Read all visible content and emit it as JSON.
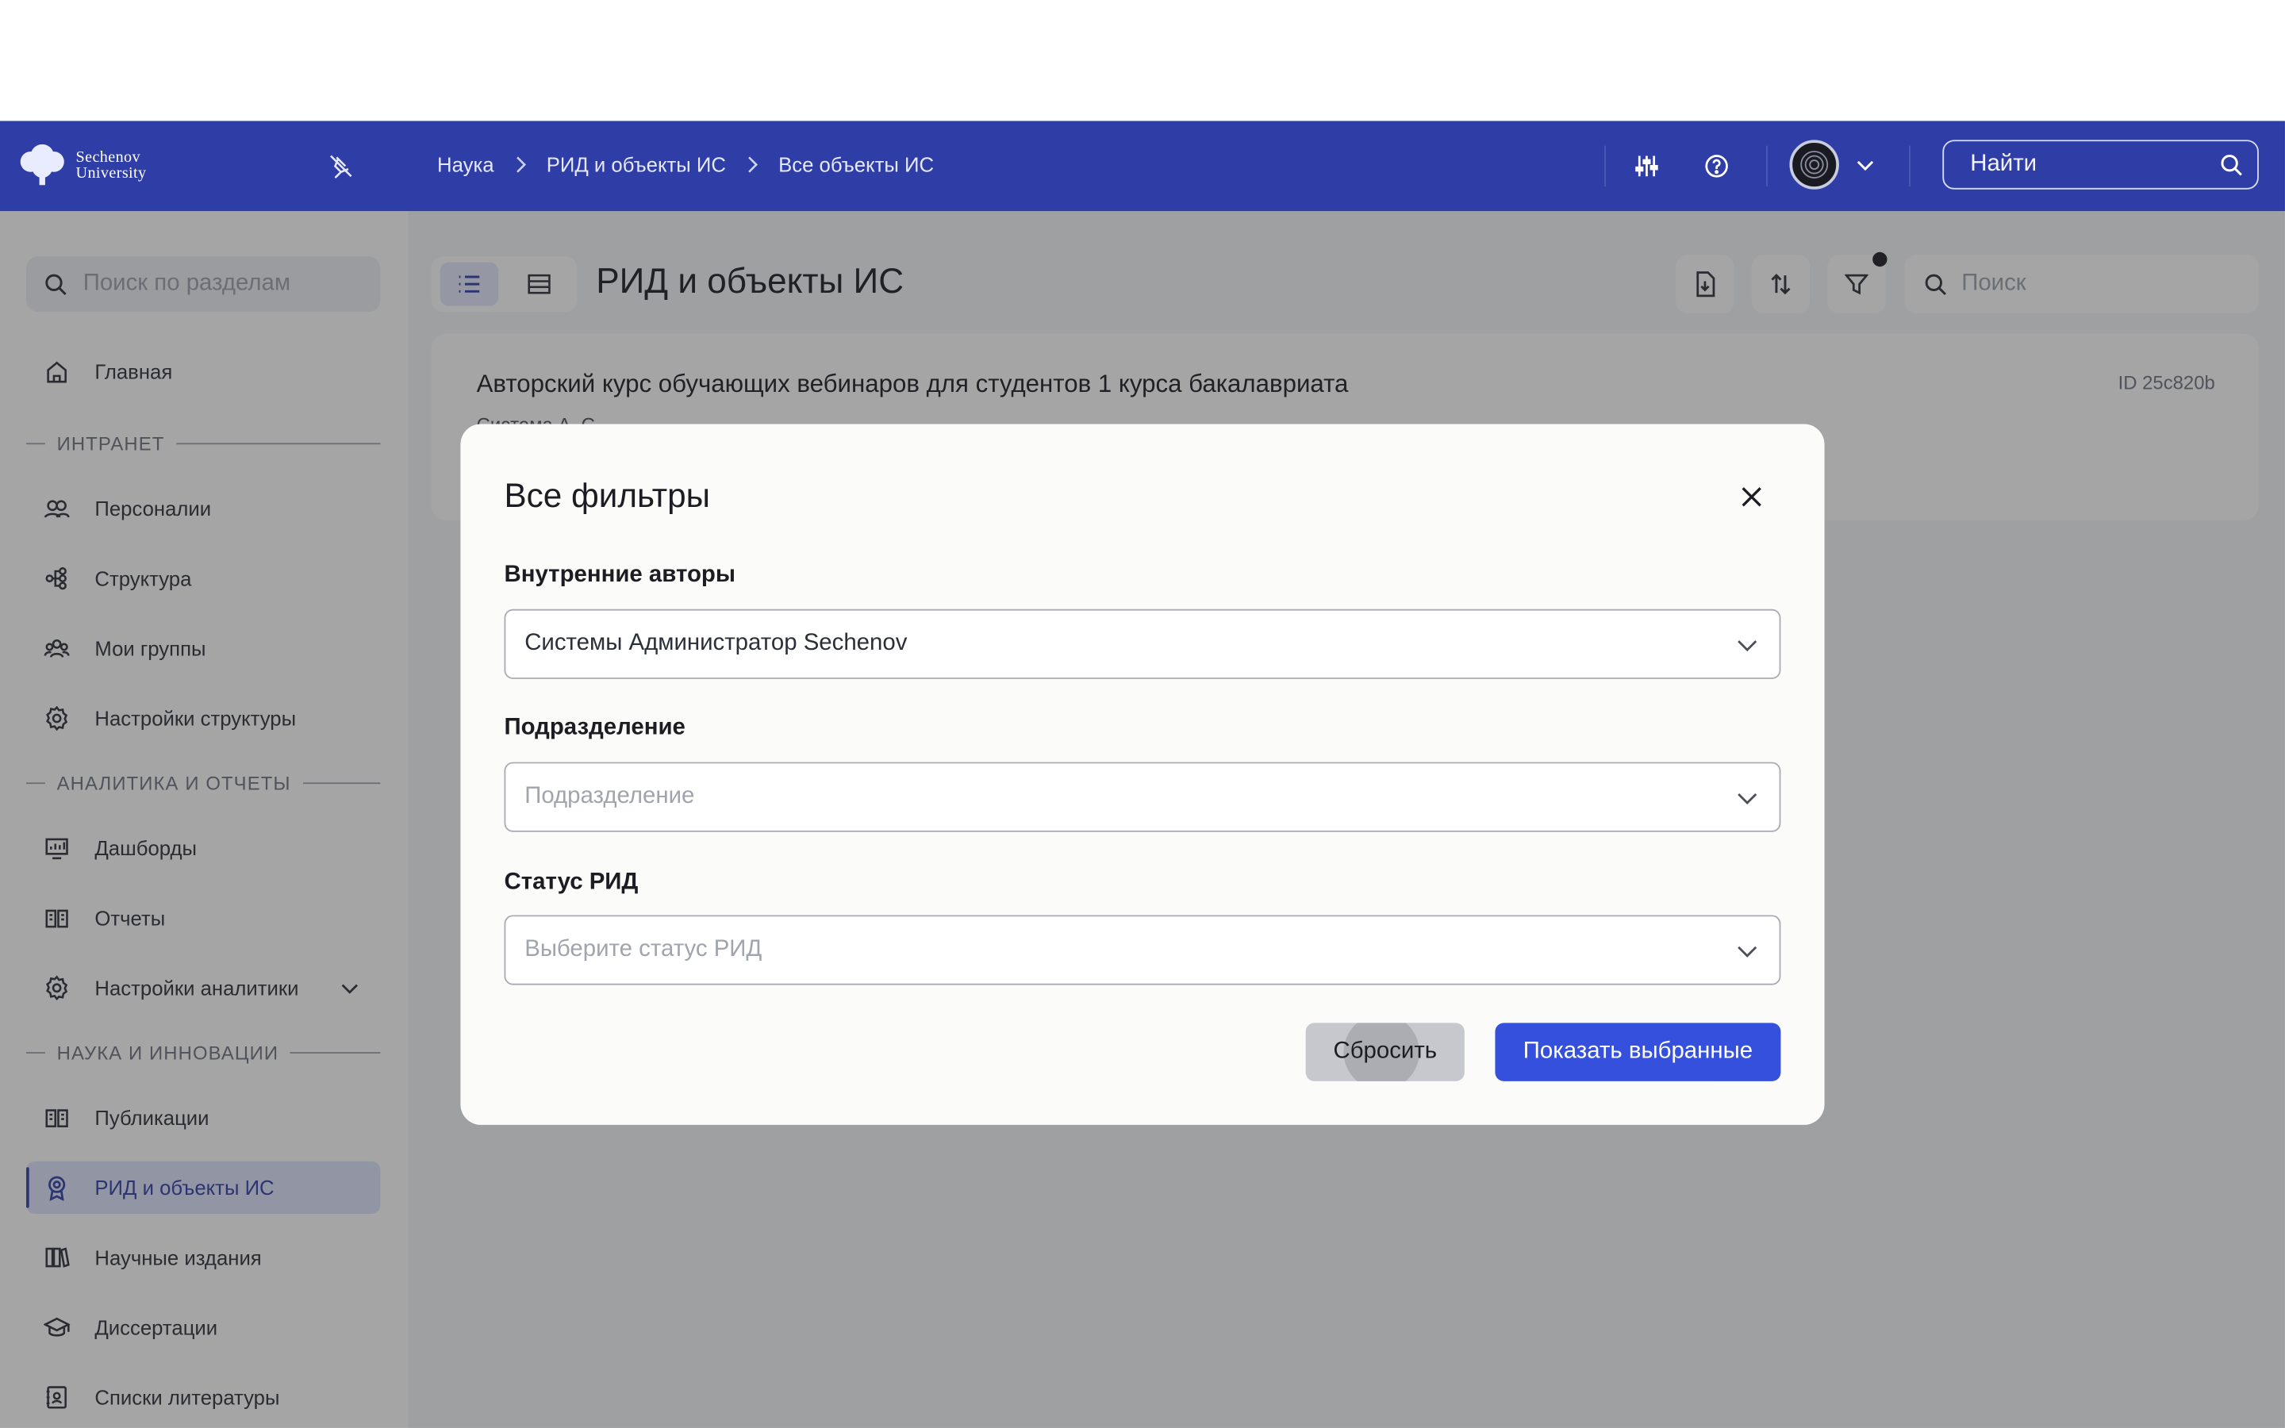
{
  "header": {
    "logo_line1": "Sechenov",
    "logo_line2": "University",
    "breadcrumbs": [
      "Наука",
      "РИД и объекты ИС",
      "Все объекты ИС"
    ],
    "search_placeholder": "Найти"
  },
  "sidebar": {
    "search_placeholder": "Поиск по разделам",
    "home": "Главная",
    "section_intranet": "ИНТРАНЕТ",
    "intranet_items": [
      "Персоналии",
      "Структура",
      "Мои группы",
      "Настройки структуры"
    ],
    "section_analytics": "АНАЛИТИКА И ОТЧЕТЫ",
    "analytics_items": [
      "Дашборды",
      "Отчеты",
      "Настройки аналитики"
    ],
    "section_science": "НАУКА И ИННОВАЦИИ",
    "science_items": [
      "Публикации",
      "РИД и объекты ИС",
      "Научные издания",
      "Диссертации",
      "Списки литературы"
    ],
    "active_item": "РИД и объекты ИС"
  },
  "main": {
    "title": "РИД и объекты ИС",
    "search_placeholder": "Поиск",
    "card": {
      "title": "Авторский курс обучающих вебинаров для студентов 1 курса бакалавриата",
      "id": "ID 25c820b",
      "subtitle": "Система А. С."
    }
  },
  "modal": {
    "title": "Все фильтры",
    "fields": [
      {
        "label": "Внутренние авторы",
        "value": "Системы Администратор Sechenov",
        "placeholder": ""
      },
      {
        "label": "Подразделение",
        "value": "",
        "placeholder": "Подразделение"
      },
      {
        "label": "Статус РИД",
        "value": "",
        "placeholder": "Выберите статус РИД"
      }
    ],
    "reset_label": "Сбросить",
    "apply_label": "Показать выбранные"
  },
  "colors": {
    "header_bg": "#2f3ea6",
    "accent": "#3550dc",
    "active_nav_bg": "#dfe3fb"
  }
}
